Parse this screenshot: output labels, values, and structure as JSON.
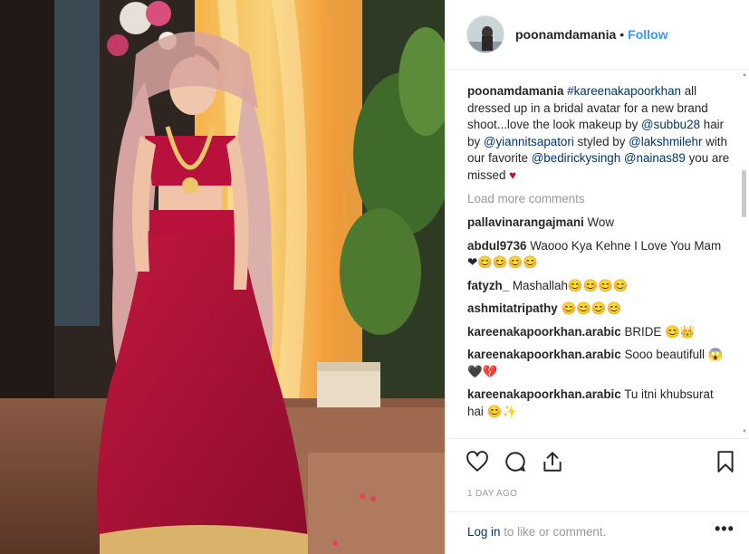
{
  "post": {
    "username": "poonamdamania",
    "dot": "•",
    "follow_label": "Follow"
  },
  "caption": {
    "username": "poonamdamania",
    "hashtag": "#kareenakapoorkhan",
    "text1": " all dressed up in a bridal avatar for a new brand shoot...love the look makeup by ",
    "mention1": "@subbu28",
    "text2": " hair by ",
    "mention2": "@yiannitsapatori",
    "text3": " styled by ",
    "mention3": "@lakshmilehr",
    "text4": " with our favorite ",
    "mention4": "@bedirickysingh",
    "text5": " ",
    "mention5": "@nainas89",
    "text6": " you are missed ",
    "heart": "♥"
  },
  "load_more_label": "Load more comments",
  "comments": [
    {
      "username": "pallavinarangajmani",
      "text": "Wow"
    },
    {
      "username": "abdul9736",
      "text": "Waooo Kya Kehne I Love You Mam❤😊😊😊😊"
    },
    {
      "username": "fatyzh_",
      "text": "Mashallah😊😊😊😊"
    },
    {
      "username": "ashmitatripathy",
      "text": "😊😊😊😊"
    },
    {
      "username": "kareenakapoorkhan.arabic",
      "text": "BRIDE 😊👑"
    },
    {
      "username": "kareenakapoorkhan.arabic",
      "text": "Sooo beautifull 😱🖤💔"
    },
    {
      "username": "kareenakapoorkhan.arabic",
      "text": "Tu itni khubsurat hai 😊✨"
    }
  ],
  "icons": {
    "like": "heart-icon",
    "comment": "speech-bubble-icon",
    "share": "share-icon",
    "save": "bookmark-icon",
    "more": "more-options-icon"
  },
  "timestamp": "1 DAY AGO",
  "login": {
    "link": "Log in",
    "text": " to like or comment."
  },
  "more_label": "•••",
  "colors": {
    "link_blue": "#3897f0",
    "mention_navy": "#003569",
    "muted": "#999999",
    "text": "#262626",
    "dress_red": "#b5123a"
  }
}
